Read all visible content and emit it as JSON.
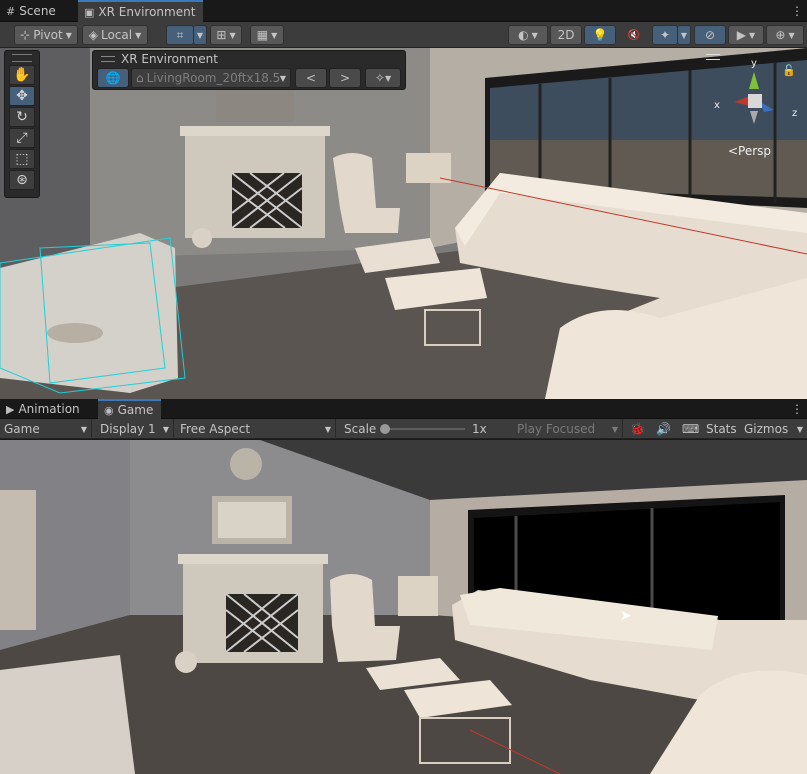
{
  "scene_tabs": [
    {
      "label": "Scene",
      "icon": "hash-icon",
      "active": false
    },
    {
      "label": "XR Environment",
      "icon": "xr-icon",
      "active": true
    }
  ],
  "scene_toolbar": {
    "pivot_label": "Pivot",
    "local_label": "Local",
    "mode_2d_label": "2D"
  },
  "tools": [
    "hand-tool",
    "move-tool",
    "rotate-tool",
    "scale-tool",
    "rect-tool",
    "transform-tool"
  ],
  "xr_panel": {
    "title": "XR Environment",
    "environment_value": "LivingRoom_20ftx18.5",
    "prev_label": "<",
    "next_label": ">"
  },
  "gizmo": {
    "x_label": "x",
    "y_label": "y",
    "z_label": "z",
    "persp_label": "<Persp"
  },
  "bottom_tabs": [
    {
      "label": "Animation",
      "icon": "animation-icon",
      "active": false
    },
    {
      "label": "Game",
      "icon": "gamepad-icon",
      "active": true
    }
  ],
  "game_bar": {
    "game_dropdown": "Game",
    "display_dropdown": "Display 1",
    "aspect_dropdown": "Free Aspect",
    "scale_label": "Scale",
    "scale_value": "1x",
    "play_focused": "Play Focused",
    "stats_label": "Stats",
    "gizmos_label": "Gizmos"
  },
  "colors": {
    "accent": "#3a79bb",
    "toggle_on": "#46607c",
    "panel_bg": "#3c3c3c",
    "tab_bg": "#191919"
  }
}
